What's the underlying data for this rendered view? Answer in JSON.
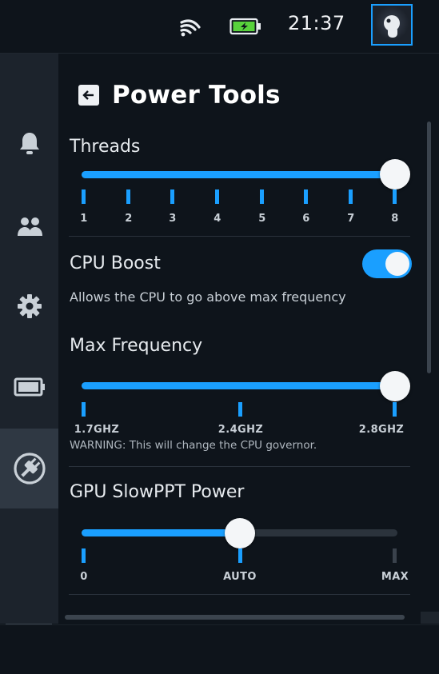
{
  "status_bar": {
    "time": "21:37",
    "battery_color": "#58d23c",
    "accent": "#1a9fff"
  },
  "rail": {
    "items": [
      {
        "name": "notifications",
        "icon": "bell-icon"
      },
      {
        "name": "friends",
        "icon": "friends-icon"
      },
      {
        "name": "settings",
        "icon": "gear-icon"
      },
      {
        "name": "performance",
        "icon": "battery-icon"
      },
      {
        "name": "plugins",
        "icon": "plug-icon",
        "active": true
      }
    ],
    "keyboard_icon": "keyboard-icon"
  },
  "panel": {
    "title": "Power Tools",
    "threads": {
      "label": "Threads",
      "value": 8,
      "ticks": [
        "1",
        "2",
        "3",
        "4",
        "5",
        "6",
        "7",
        "8"
      ]
    },
    "cpu_boost": {
      "label": "CPU Boost",
      "enabled": true,
      "description": "Allows the CPU to go above max frequency"
    },
    "max_frequency": {
      "label": "Max Frequency",
      "ticks": [
        "1.7GHZ",
        "2.4GHZ",
        "2.8GHZ"
      ],
      "value": "2.8GHZ",
      "warning": "WARNING: This will change the CPU governor."
    },
    "gpu_slowppt": {
      "label": "GPU SlowPPT Power",
      "ticks": [
        "0",
        "AUTO",
        "MAX"
      ],
      "value": "AUTO"
    }
  }
}
